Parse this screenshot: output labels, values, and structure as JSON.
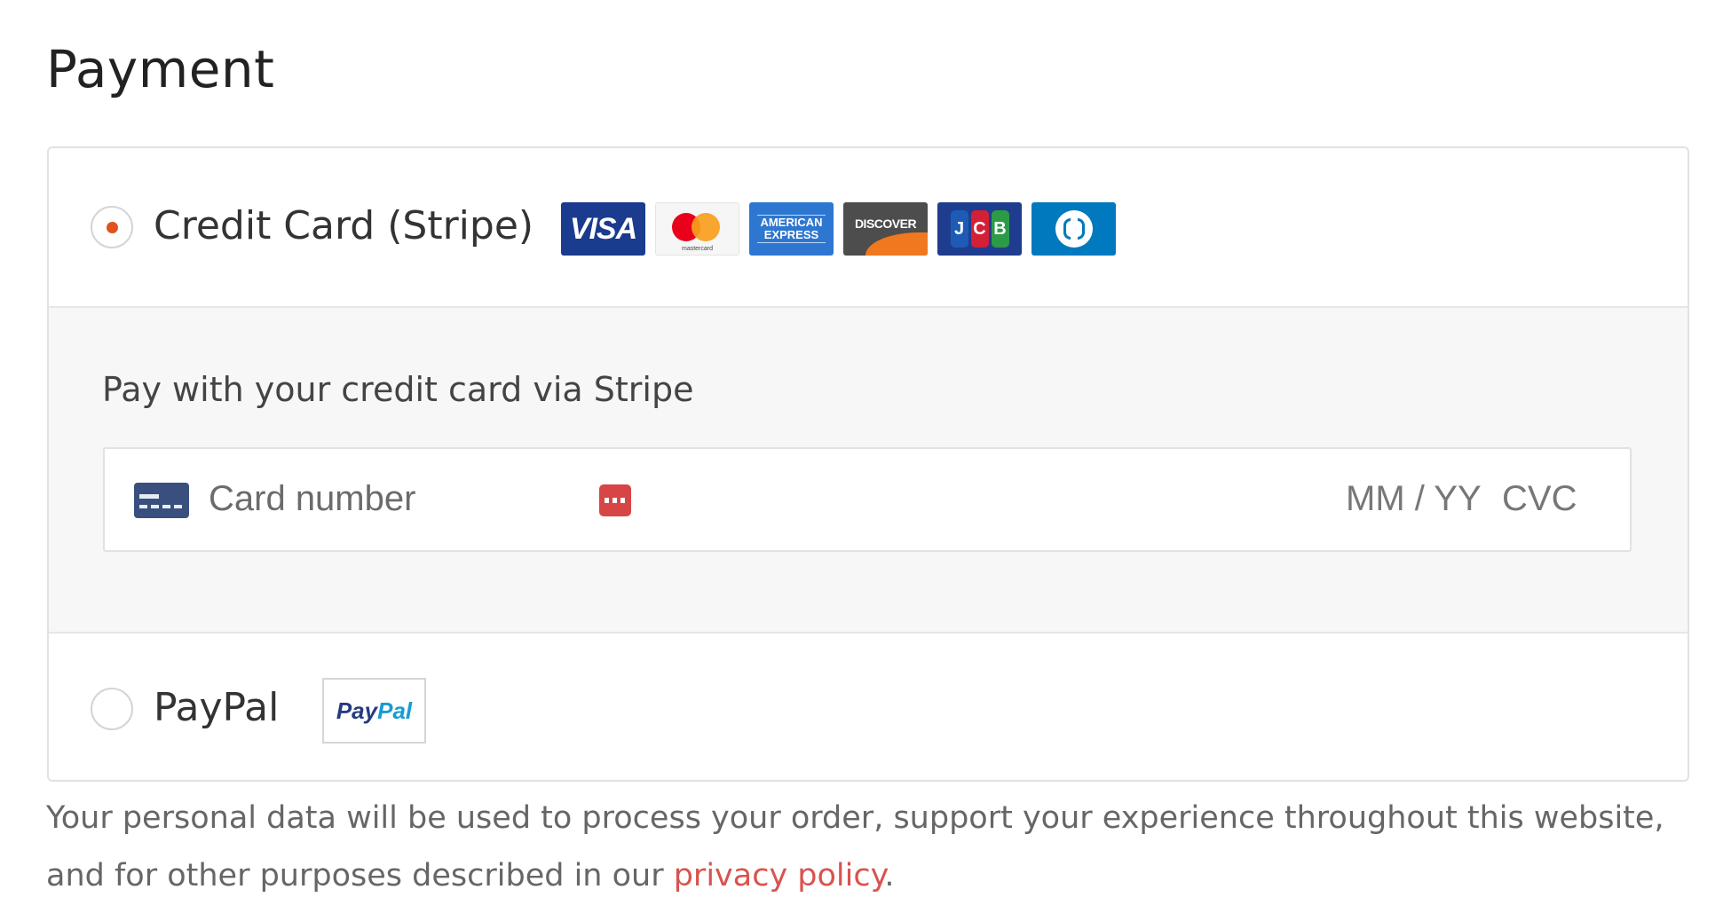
{
  "page": {
    "title": "Payment"
  },
  "methods": {
    "credit_card": {
      "label": "Credit Card (Stripe)",
      "selected": true,
      "card_brands": [
        "visa",
        "mastercard",
        "american-express",
        "discover",
        "jcb",
        "diners-club"
      ],
      "logos": {
        "visa": "VISA",
        "mastercard": "mastercard",
        "amex_1": "AMERICAN",
        "amex_2": "EXPRESS",
        "discover": "DISCOVER",
        "jcb_1": "J",
        "jcb_2": "C",
        "jcb_3": "B"
      },
      "description": "Pay with your credit card via Stripe",
      "card_number_placeholder": "Card number",
      "expiry_placeholder": "MM / YY",
      "cvc_placeholder": "CVC"
    },
    "paypal": {
      "label": "PayPal",
      "selected": false,
      "logo_part1": "Pay",
      "logo_part2": "Pal"
    }
  },
  "privacy": {
    "text_before": "Your personal data will be used to process your order, support your experience throughout this website, and for other purposes described in our ",
    "link_text": "privacy policy",
    "text_after": "."
  },
  "colors": {
    "accent": "#e0531f",
    "link": "#d9534f",
    "panel_bg": "#f7f7f7",
    "border": "#e2e2e2"
  }
}
